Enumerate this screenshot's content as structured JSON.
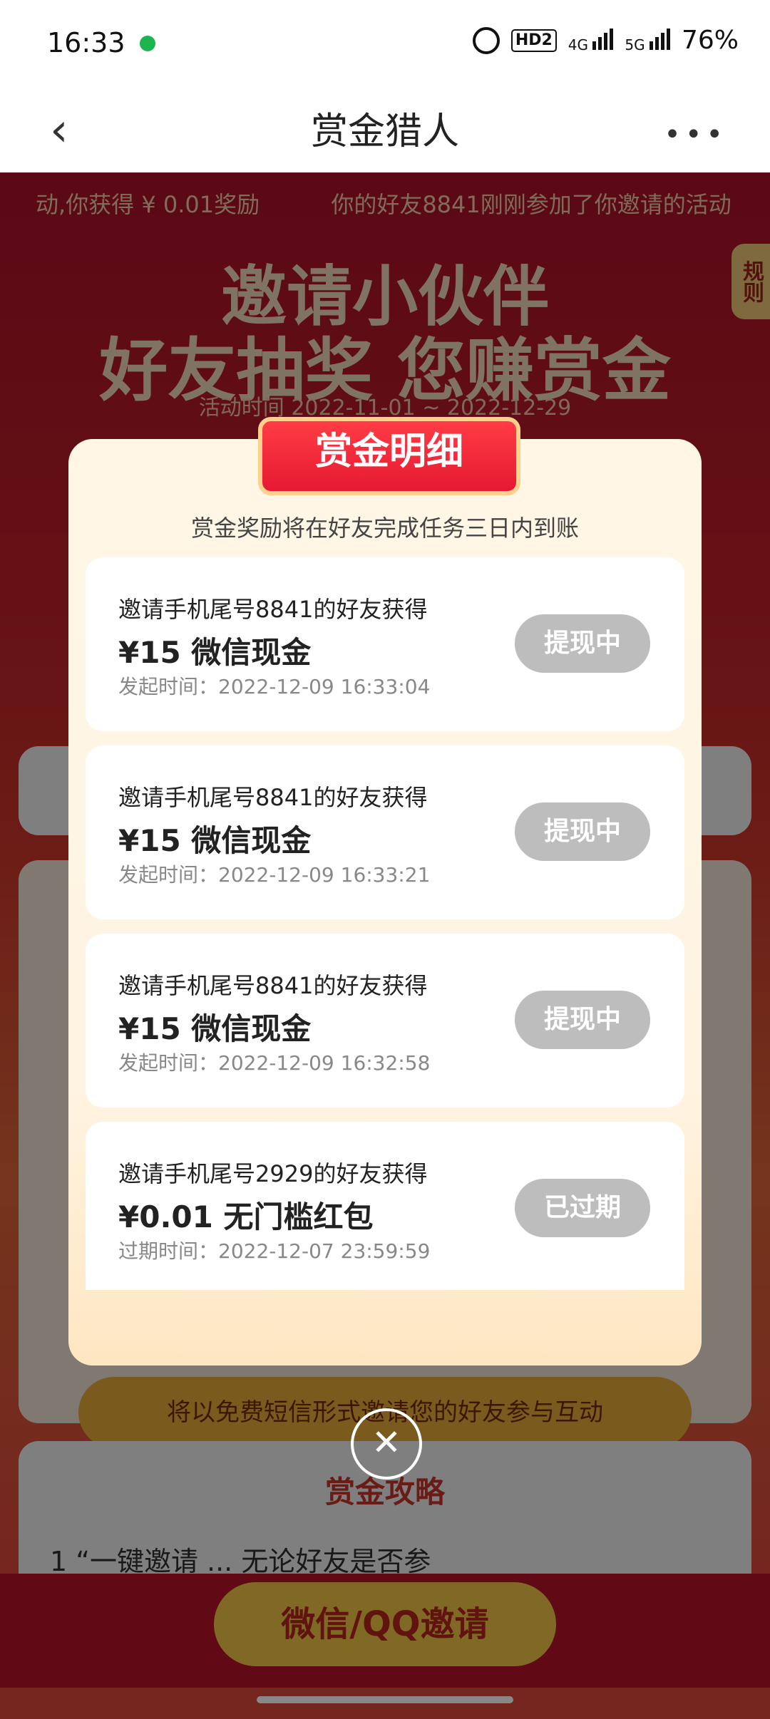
{
  "status": {
    "time": "16:33",
    "battery": "76%",
    "net1": "4G",
    "net2": "5G",
    "hd": "HD2"
  },
  "header": {
    "title": "赏金猎人",
    "back_icon": "chevron-left-icon",
    "more_icon": "more-dots-icon"
  },
  "background": {
    "ticker": [
      "动,你获得 ¥ 0.01奖励",
      "你的好友8841刚刚参加了你邀请的活动"
    ],
    "banner_line1": "邀请小伙伴",
    "banner_line2": "好友抽奖 您赚赏金",
    "period": "活动时间 2022-11-01 ~ 2022-12-29",
    "rule_tab": "规则",
    "sms_text": "将以免费短信形式邀请您的好友参与互动",
    "strategy_title": "赏金攻略",
    "strategy_rule1": "1 “一键邀请 ... 无论好友是否参",
    "invite_button": "微信/QQ邀请"
  },
  "modal": {
    "badge": "赏金明细",
    "subtitle": "赏金奖励将在好友完成任务三日内到账",
    "items": [
      {
        "desc": "邀请手机尾号8841的好友获得",
        "amount": "¥15 微信现金",
        "time": "发起时间：2022-12-09 16:33:04",
        "status": "提现中"
      },
      {
        "desc": "邀请手机尾号8841的好友获得",
        "amount": "¥15 微信现金",
        "time": "发起时间：2022-12-09 16:33:21",
        "status": "提现中"
      },
      {
        "desc": "邀请手机尾号8841的好友获得",
        "amount": "¥15 微信现金",
        "time": "发起时间：2022-12-09 16:32:58",
        "status": "提现中"
      },
      {
        "desc": "邀请手机尾号2929的好友获得",
        "amount": "¥0.01 无门槛红包",
        "time": "过期时间：2022-12-07 23:59:59",
        "status": "已过期"
      }
    ],
    "close_icon": "close-icon"
  },
  "colors": {
    "accent": "#e61933",
    "button_disabled": "#bdbdbd",
    "modal_bg": "#fff6e6"
  }
}
